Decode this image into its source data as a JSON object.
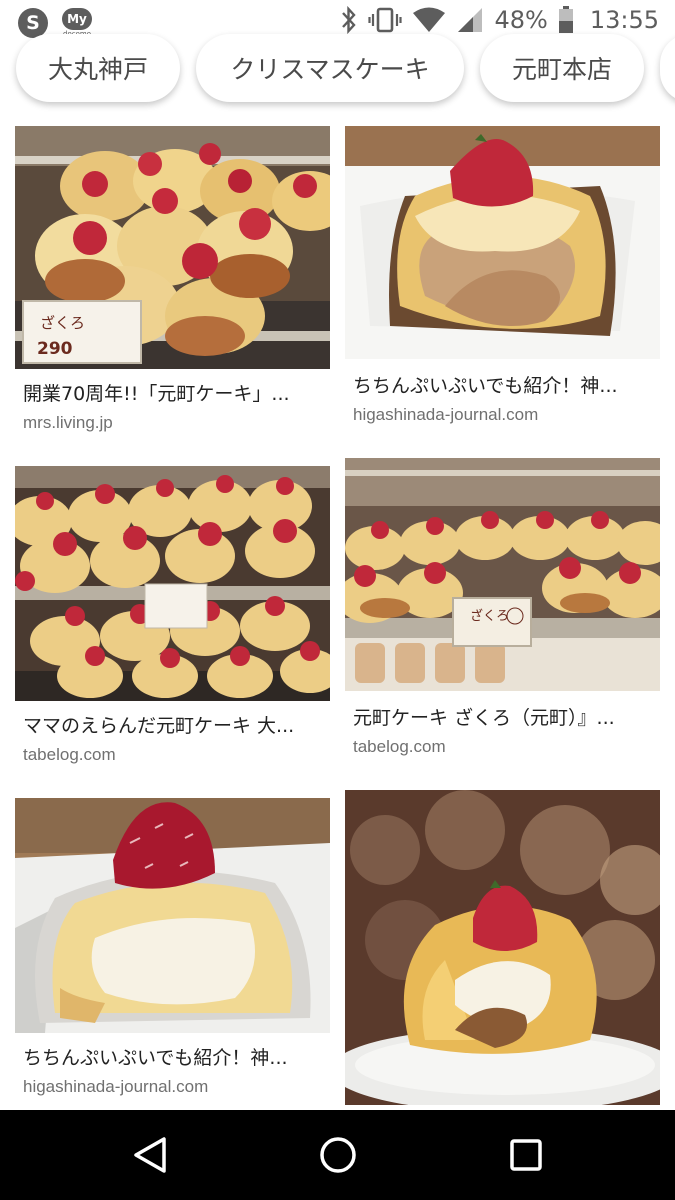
{
  "status_bar": {
    "app_icon_s": "S",
    "app_icon_my": "My",
    "app_icon_my_sub": "docomo",
    "icons": [
      "bluetooth-icon",
      "vibrate-icon",
      "wifi-icon",
      "signal-icon",
      "battery-icon"
    ],
    "battery_percent": "48%",
    "time": "13:55"
  },
  "chips": [
    {
      "label": "大丸神戸"
    },
    {
      "label": "クリスマスケーキ"
    },
    {
      "label": "元町本店"
    }
  ],
  "results": [
    {
      "title": "開業70周年!!「元町ケーキ」...",
      "source": "mrs.living.jp",
      "thumb_label": "ざくろ",
      "thumb_price": "290"
    },
    {
      "title": "ちちんぷいぷいでも紹介！神...",
      "source": "higashinada-journal.com"
    },
    {
      "title": "ママのえらんだ元町ケーキ 大...",
      "source": "tabelog.com"
    },
    {
      "title": "元町ケーキ ざくろ（元町）』...",
      "source": "tabelog.com",
      "thumb_label": "ざくろ"
    },
    {
      "title": "ちちんぷいぷいでも紹介！神...",
      "source": "higashinada-journal.com"
    },
    {
      "title": "",
      "source": ""
    }
  ],
  "nav_bar": {
    "icons": [
      "back-triangle-icon",
      "home-circle-icon",
      "recents-square-icon"
    ]
  },
  "colors": {
    "strawberry": "#c0283a",
    "cream": "#f4dc9a",
    "chip_text": "#4a4a4a",
    "source_text": "#707070"
  }
}
